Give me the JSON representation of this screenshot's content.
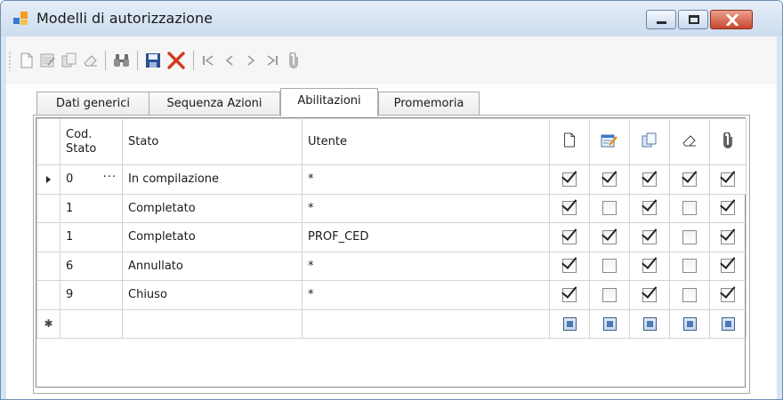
{
  "window": {
    "title": "Modelli di autorizzazione",
    "controls": {
      "minimize": "minimize-icon",
      "maximize": "maximize-icon",
      "close": "close-icon"
    }
  },
  "toolbar": {
    "buttons": [
      {
        "name": "new-icon"
      },
      {
        "name": "edit-icon"
      },
      {
        "name": "copy-icon"
      },
      {
        "name": "eraser-icon"
      },
      {
        "name": "find-icon"
      },
      {
        "name": "save-icon"
      },
      {
        "name": "delete-icon"
      },
      {
        "name": "first-record-icon"
      },
      {
        "name": "previous-record-icon"
      },
      {
        "name": "next-record-icon"
      },
      {
        "name": "last-record-icon"
      },
      {
        "name": "attachment-icon"
      }
    ]
  },
  "tabs": [
    {
      "label": "Dati generici",
      "active": false
    },
    {
      "label": "Sequenza Azioni",
      "active": false
    },
    {
      "label": "Abilitazioni",
      "active": true
    },
    {
      "label": "Promemoria",
      "active": false
    }
  ],
  "grid": {
    "columns": {
      "cod_stato": "Cod.\nStato",
      "cod_line1": "Cod.",
      "cod_line2": "Stato",
      "stato": "Stato",
      "utente": "Utente",
      "icon_columns": [
        "new-icon",
        "edit-icon",
        "copy-icon",
        "eraser-icon",
        "attachment-icon"
      ]
    },
    "rows": [
      {
        "cod": "0",
        "stato": "In compilazione",
        "utente": "*",
        "current": true,
        "flags": [
          true,
          true,
          true,
          true,
          true
        ]
      },
      {
        "cod": "1",
        "stato": "Completato",
        "utente": "*",
        "current": false,
        "flags": [
          true,
          false,
          true,
          false,
          true
        ]
      },
      {
        "cod": "1",
        "stato": "Completato",
        "utente": "PROF_CED",
        "current": false,
        "flags": [
          true,
          true,
          true,
          false,
          true
        ]
      },
      {
        "cod": "6",
        "stato": "Annullato",
        "utente": "*",
        "current": false,
        "flags": [
          true,
          false,
          true,
          false,
          true
        ]
      },
      {
        "cod": "9",
        "stato": "Chiuso",
        "utente": "*",
        "current": false,
        "flags": [
          true,
          false,
          true,
          false,
          true
        ]
      }
    ],
    "current_row_ellipsis": "···",
    "new_row_marker": "✱"
  },
  "colors": {
    "title_bar": "#d7e4f2",
    "close_button": "#c8472d",
    "save_icon": "#2a4f94",
    "delete_icon": "#d23a1c"
  }
}
